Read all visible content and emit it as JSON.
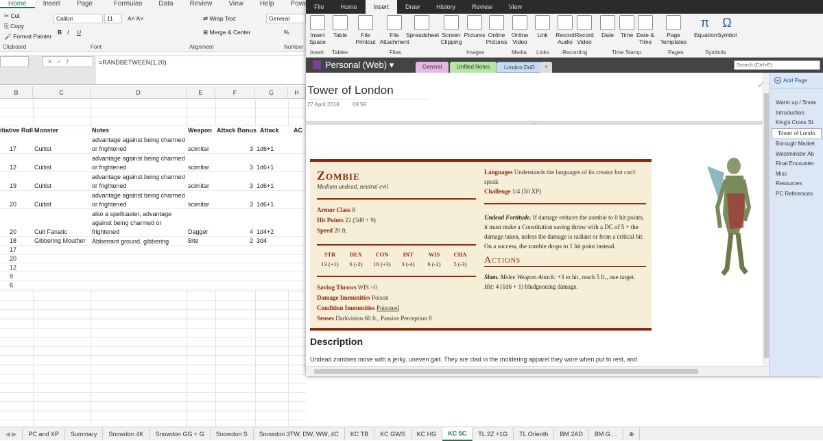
{
  "excel": {
    "ribbon_tabs": [
      "Home",
      "Insert",
      "Page Layout",
      "Formulas",
      "Data",
      "Review",
      "View",
      "Help",
      "Power Pivot"
    ],
    "clipboard": {
      "cut": "Cut",
      "copy": "Copy",
      "painter": "Format Painter",
      "group": "Clipboard"
    },
    "font": {
      "name": "Calibri",
      "size": "11",
      "group": "Font"
    },
    "alignment": {
      "wrap": "Wrap Text",
      "merge": "Merge & Center",
      "group": "Alignment"
    },
    "number": {
      "format": "General",
      "group": "Number",
      "percent": "%"
    },
    "formula": "=RANDBETWEEN(1,20)",
    "columns": [
      "B",
      "C",
      "D",
      "E",
      "F",
      "G",
      "H"
    ],
    "headers": {
      "init": "itiative Roll",
      "monster": "Monster",
      "notes": "Notes",
      "weapon": "Weapon",
      "attack_bonus": "Attack Bonus",
      "attack": "Attack",
      "ac": "AC"
    },
    "rows": [
      {
        "init": "17",
        "monster": "Cultist",
        "notes": "advantage against being charmed or frightened",
        "weapon": "scimitar",
        "bonus": "3",
        "attack": "1d6+1"
      },
      {
        "init": "12",
        "monster": "Cultist",
        "notes": "advantage against being charmed or frightened",
        "weapon": "scimitar",
        "bonus": "3",
        "attack": "1d6+1"
      },
      {
        "init": "19",
        "monster": "Cultist",
        "notes": "advantage against being charmed or frightened",
        "weapon": "scimitar",
        "bonus": "3",
        "attack": "1d6+1"
      },
      {
        "init": "20",
        "monster": "Cultist",
        "notes": "advantage against being charmed or frightened",
        "weapon": "scimitar",
        "bonus": "3",
        "attack": "1d6+1"
      },
      {
        "init": "20",
        "monster": "Cult Fanatic",
        "notes": "also a spellcaster, advantage against being charmed or frightened",
        "weapon": "Dagger",
        "bonus": "4",
        "attack": "1d4+2"
      },
      {
        "init": "18",
        "monster": "Gibbering Mouther",
        "notes": "Abberrant ground, gibbering",
        "weapon": "Bite",
        "bonus": "2",
        "attack": "3d4"
      },
      {
        "init": "17"
      },
      {
        "init": "20"
      },
      {
        "init": "12"
      },
      {
        "init": "9"
      },
      {
        "init": "6"
      }
    ],
    "sheets": [
      "PC and XP",
      "Summary",
      "Snowdon 4K",
      "Snowdon GG + G",
      "Snowdon S",
      "Snowdon 3TW, DW, WW, 4C",
      "KC TB",
      "KC GWS",
      "KC HG",
      "KC 5C",
      "TL 2Z +1G",
      "TL Orieoth",
      "BM 2AD",
      "BM G ..."
    ],
    "active_sheet": "KC 5C"
  },
  "onenote": {
    "tabs": [
      "File",
      "Home",
      "Insert",
      "Draw",
      "History",
      "Review",
      "View"
    ],
    "active_tab": "Insert",
    "ribbon": [
      {
        "label": "Insert Space",
        "group": "Insert"
      },
      {
        "label": "Table",
        "group": "Tables"
      },
      {
        "label": "File Printout"
      },
      {
        "label": "File Attachment",
        "group": "Files"
      },
      {
        "label": "Spreadsheet"
      },
      {
        "label": "Screen Clipping"
      },
      {
        "label": "Pictures",
        "group": "Images"
      },
      {
        "label": "Online Pictures"
      },
      {
        "label": "Online Video",
        "group": "Media"
      },
      {
        "label": "Link",
        "group": "Links"
      },
      {
        "label": "Record Audio",
        "group": "Recording"
      },
      {
        "label": "Record Video"
      },
      {
        "label": "Date"
      },
      {
        "label": "Time",
        "group": "Time Stamp"
      },
      {
        "label": "Date & Time"
      },
      {
        "label": "Page Templates",
        "group": "Pages"
      },
      {
        "label": "Equation",
        "group": "Symbols"
      },
      {
        "label": "Symbol"
      }
    ],
    "notebook": "Personal (Web)",
    "section_tabs": [
      "General",
      "Unfiled Notes",
      "London DnD"
    ],
    "search_placeholder": "Search (Ctrl+E)",
    "page_title": "Tower of London",
    "page_date": "27 April 2018",
    "page_time": "09:59",
    "statblock": {
      "name": "Zombie",
      "type": "Medium undead, neutral evil",
      "armor_class_label": "Armor Class",
      "armor_class": "8",
      "hp_label": "Hit Points",
      "hp": "22 (3d8 + 9)",
      "speed_label": "Speed",
      "speed": "20 ft.",
      "abilities": [
        {
          "name": "STR",
          "value": "13 (+1)"
        },
        {
          "name": "DEX",
          "value": "6 (-2)"
        },
        {
          "name": "CON",
          "value": "16 (+3)"
        },
        {
          "name": "INT",
          "value": "3 (-4)"
        },
        {
          "name": "WIS",
          "value": "6 (-2)"
        },
        {
          "name": "CHA",
          "value": "5 (-3)"
        }
      ],
      "saving_label": "Saving Throws",
      "saving": "WIS +0",
      "dmg_imm_label": "Damage Immunities",
      "dmg_imm": "Poison",
      "cond_imm_label": "Condition Immunities",
      "cond_imm": "Poisoned",
      "senses_label": "Senses",
      "senses": "Darkvision 60 ft., Passive Perception 8",
      "languages_label": "Languages",
      "languages": "Understands the languages of its creator but can't speak",
      "challenge_label": "Challenge",
      "challenge": "1/4 (50 XP)",
      "trait_name": "Undead Fortitude.",
      "trait_text": "If damage reduces the zombie to 0 hit points, it must make a Constitution saving throw with a DC of 5 + the damage taken, unless the damage is radiant or from a critical hit. On a success, the zombie drops to 1 hit point instead.",
      "actions_heading": "Actions",
      "action_name": "Slam.",
      "action_type": "Melee Weapon Attack:",
      "action_text": "+3 to hit, reach 5 ft., one target.",
      "hit_label": "Hit:",
      "hit_text": "4 (1d6 + 1) bludgeoning damage."
    },
    "description_heading": "Description",
    "description_text": "Undead zombies move with a jerky, uneven gait. They are clad in the moldering apparel they wore when put to rest, and",
    "add_page": "Add Page",
    "pages": [
      "Warm up / Snow",
      "Introduction",
      "King's Cross St.",
      "Tower of Londo",
      "Borough Market",
      "Westminster Ab",
      "Final Encounter",
      "Misc",
      "Resources",
      "PC References"
    ],
    "selected_page": "Tower of Londo"
  },
  "colors": {
    "excel_green": "#217346",
    "statblock_red": "#8c2a10",
    "onenote_purple": "#7a3e9d"
  }
}
